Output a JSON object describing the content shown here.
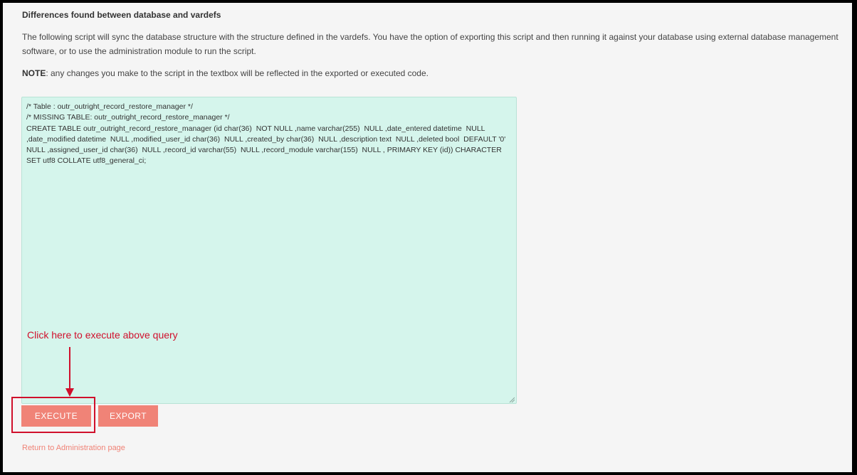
{
  "section": {
    "title": "Differences found between database and vardefs"
  },
  "intro": {
    "text": "The following script will sync the database structure with the structure defined in the vardefs. You have the option of exporting this script and then running it against your database using external database management software, or to use the administration module to run the script."
  },
  "note": {
    "label": "NOTE",
    "text": ": any changes you make to the script in the textbox will be reflected in the exported or executed code."
  },
  "script": {
    "value": "/* Table : outr_outright_record_restore_manager */\n/* MISSING TABLE: outr_outright_record_restore_manager */\nCREATE TABLE outr_outright_record_restore_manager (id char(36)  NOT NULL ,name varchar(255)  NULL ,date_entered datetime  NULL ,date_modified datetime  NULL ,modified_user_id char(36)  NULL ,created_by char(36)  NULL ,description text  NULL ,deleted bool  DEFAULT '0' NULL ,assigned_user_id char(36)  NULL ,record_id varchar(55)  NULL ,record_module varchar(155)  NULL , PRIMARY KEY (id)) CHARACTER SET utf8 COLLATE utf8_general_ci;"
  },
  "annotation": {
    "text": "Click here to execute above query",
    "color": "#d0102c"
  },
  "buttons": {
    "execute": "EXECUTE",
    "export": "EXPORT"
  },
  "links": {
    "return": "Return to Administration page"
  },
  "colors": {
    "accent": "#f08377",
    "textarea_bg": "#d5f5ec",
    "page_bg": "#f5f5f5"
  }
}
